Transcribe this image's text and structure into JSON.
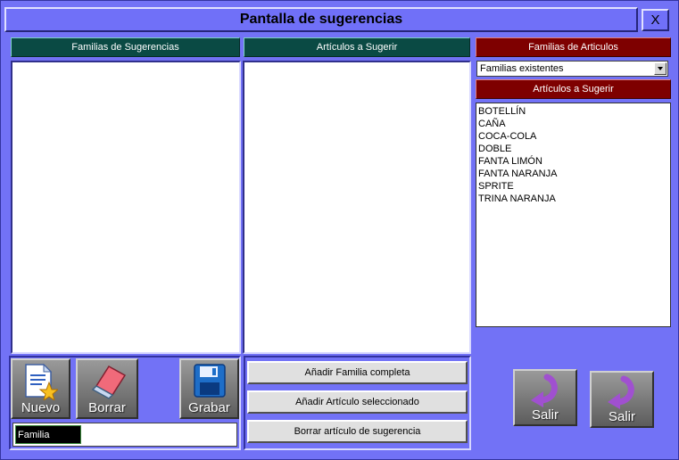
{
  "window": {
    "title": "Pantalla de sugerencias",
    "close_label": "X"
  },
  "families_panel": {
    "header": "Familias de Sugerencias",
    "items": []
  },
  "articles_panel": {
    "header": "Artículos a Sugerir",
    "items": []
  },
  "article_families": {
    "header": "Familias de Articulos",
    "combo_value": "Familias existentes"
  },
  "available_articles": {
    "header": "Artículos a Sugerir",
    "items": [
      "BOTELLÍN",
      "CAÑA",
      "COCA-COLA",
      "DOBLE",
      "FANTA LIMÓN",
      "FANTA NARANJA",
      "SPRITE",
      "TRINA NARANJA"
    ]
  },
  "toolbar": {
    "new_label": "Nuevo",
    "delete_label": "Borrar",
    "save_label": "Grabar"
  },
  "family_field": {
    "label": "Familia",
    "value": ""
  },
  "actions": {
    "add_family": "Añadir Familia completa",
    "add_article": "Añadir Artículo seleccionado",
    "remove_article": "Borrar artículo de sugerencia"
  },
  "exit_buttons": {
    "exit1_label": "Salir",
    "exit2_label": "Salir"
  },
  "colors": {
    "background": "#7272f6",
    "teal_header": "#0a4a44",
    "red_header": "#7e0000"
  },
  "icons": {
    "new": "new-document-icon",
    "delete": "eraser-icon",
    "save": "floppy-disk-icon",
    "exit": "curved-arrow-icon"
  }
}
